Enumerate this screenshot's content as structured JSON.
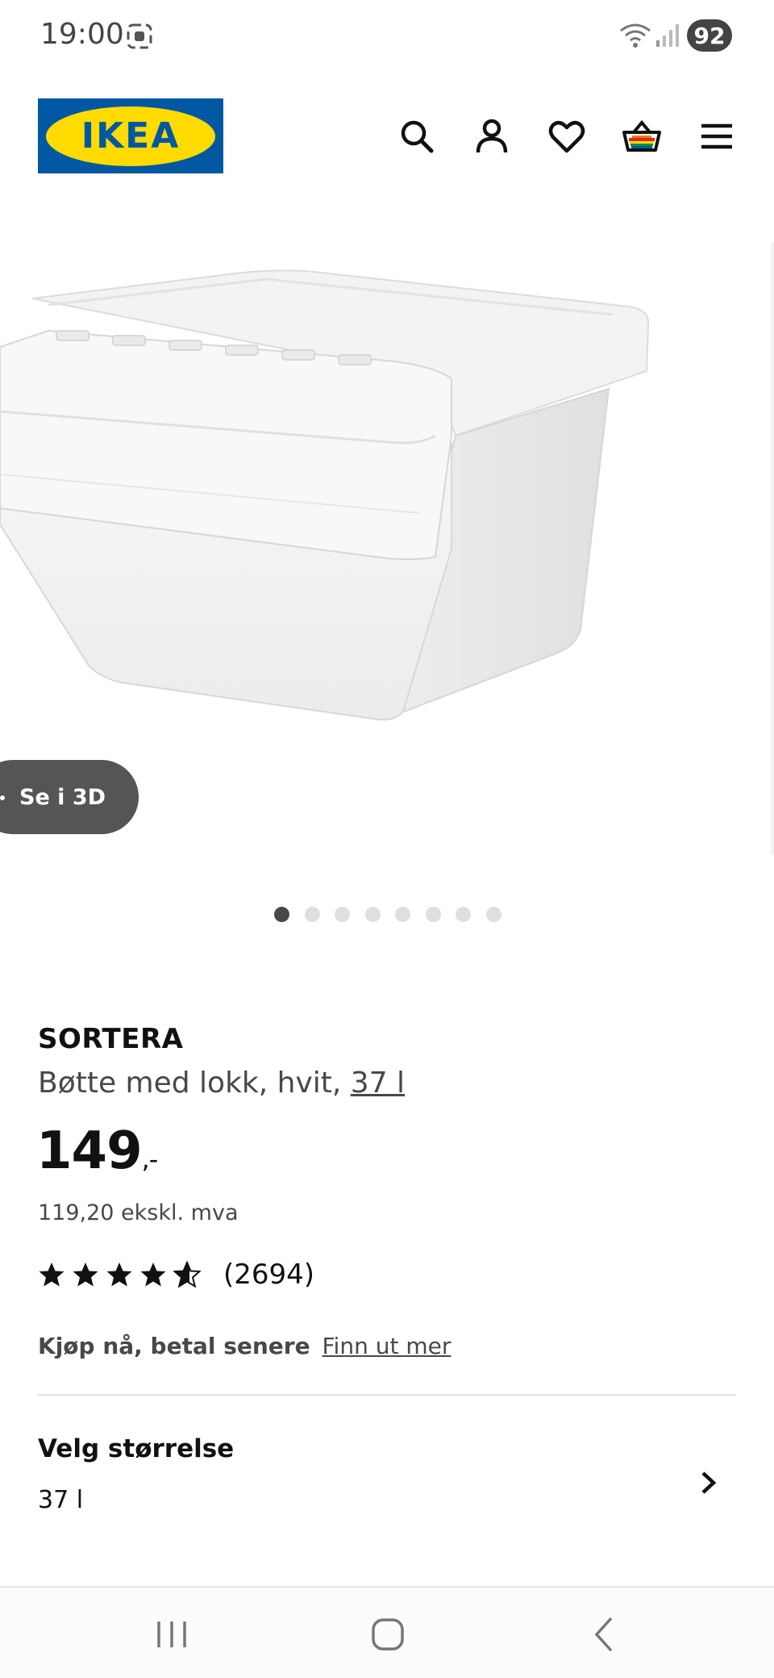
{
  "status_bar": {
    "time": "19:00",
    "battery": "92"
  },
  "header": {
    "logo_text": "IKEA",
    "icons": [
      "search-icon",
      "account-icon",
      "favorites-icon",
      "cart-icon",
      "menu-icon"
    ]
  },
  "gallery": {
    "view_3d_label": "Se i 3D",
    "image_count": 8,
    "active_index": 0
  },
  "product": {
    "name": "SORTERA",
    "description": "Bøtte med lokk, hvit, ",
    "size_link": "37 l",
    "price": "149",
    "price_suffix": ",-",
    "price_ex_vat": "119,20 ekskl. mva",
    "rating": 4.5,
    "rating_count": "(2694)",
    "pay_later_bold": "Kjøp nå, betal senere",
    "pay_later_link": "Finn ut mer"
  },
  "size_selector": {
    "title": "Velg størrelse",
    "value": "37 l"
  },
  "colors": {
    "ikea_blue": "#0058a3",
    "ikea_yellow": "#ffdb00",
    "button_3d": "#555555"
  }
}
